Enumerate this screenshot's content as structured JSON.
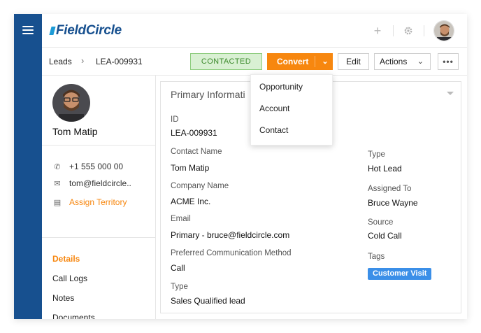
{
  "app": {
    "logo_text": "FieldCircle",
    "brand_color": "#17508f",
    "accent_color": "#f7870f"
  },
  "topbar": {
    "plus_icon": "plus-icon",
    "gear_icon": "gear-icon",
    "avatar": "user-avatar"
  },
  "breadcrumb": {
    "root": "Leads",
    "separator": "›",
    "current": "LEA-009931"
  },
  "toolbar": {
    "status_badge": "CONTACTED",
    "convert_label": "Convert",
    "edit_label": "Edit",
    "actions_label": "Actions",
    "more_label": "•••"
  },
  "convert_menu": {
    "items": [
      "Opportunity",
      "Account",
      "Contact"
    ]
  },
  "profile": {
    "name": "Tom Matip",
    "phone": "+1 555 000 00",
    "email": "tom@fieldcircle..",
    "assign_label": "Assign Territory"
  },
  "side_nav": {
    "items": [
      "Details",
      "Call Logs",
      "Notes",
      "Documents"
    ],
    "active": "Details"
  },
  "primary_info": {
    "title": "Primary Informati",
    "left_fields": [
      {
        "label": "ID",
        "value": "LEA-009931"
      },
      {
        "label": "Contact Name",
        "value": "Tom Matip"
      },
      {
        "label": "Company Name",
        "value": "ACME Inc."
      },
      {
        "label": "Email",
        "value": "Primary - bruce@fieldcircle.com"
      },
      {
        "label": "Preferred Communication Method",
        "value": "Call"
      },
      {
        "label": "Type",
        "value": "Sales Qualified lead"
      }
    ],
    "right_fields": [
      {
        "label": "Type",
        "value": "Hot Lead"
      },
      {
        "label": "Assigned To",
        "value": "Bruce Wayne"
      },
      {
        "label": "Source",
        "value": "Cold Call"
      },
      {
        "label": "Tags",
        "value": ""
      }
    ],
    "tag": "Customer Visit"
  }
}
